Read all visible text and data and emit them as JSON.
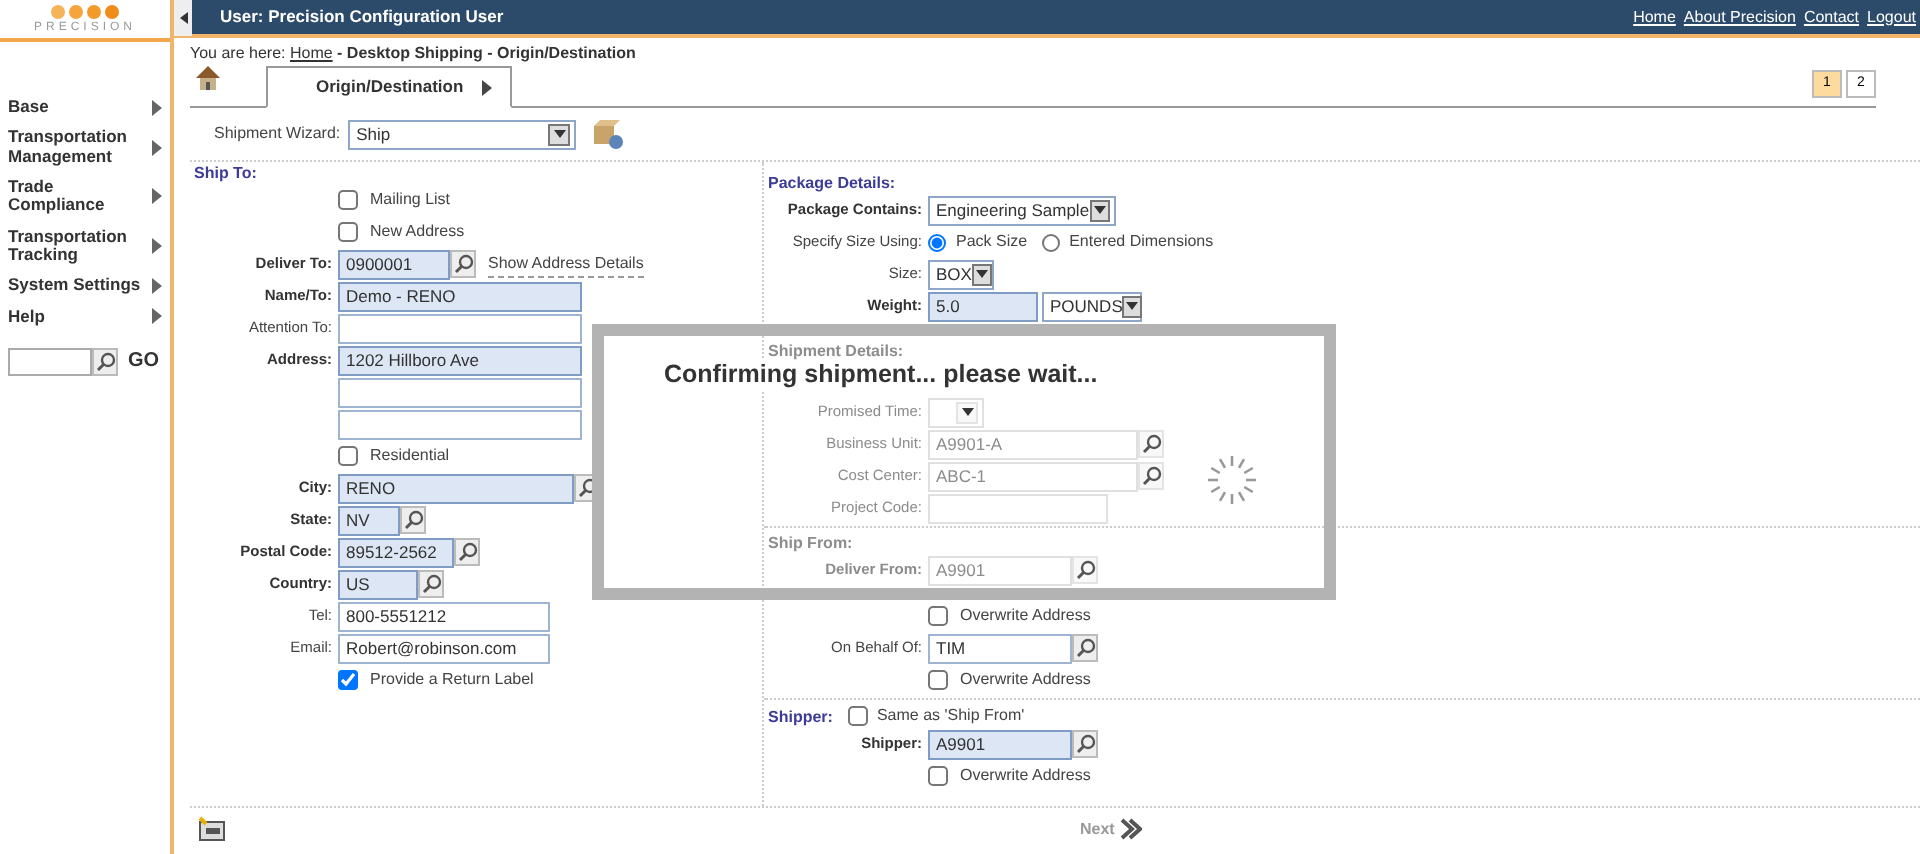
{
  "logo": {
    "text": "PRECISION"
  },
  "header": {
    "user": "User: Precision Configuration User",
    "links": [
      "Home",
      "About Precision",
      "Contact",
      "Logout"
    ]
  },
  "sidebar": {
    "items": [
      {
        "label": "Base"
      },
      {
        "label": "Transportation Management"
      },
      {
        "label": "Trade Compliance"
      },
      {
        "label": "Transportation Tracking"
      },
      {
        "label": "System Settings"
      },
      {
        "label": "Help"
      }
    ],
    "go": "GO"
  },
  "breadcrumb": {
    "prefix": "You are here:",
    "link": "Home",
    "rest": "- Desktop Shipping - Origin/Destination"
  },
  "tabs": [
    {
      "label": "Origin/Destination",
      "selected": true
    }
  ],
  "pager": [
    {
      "label": "1",
      "selected": true
    },
    {
      "label": "2",
      "selected": false
    }
  ],
  "wizard": {
    "label": "Shipment Wizard:",
    "value": "Ship"
  },
  "ship_to": {
    "title": "Ship To:",
    "fields": [
      {
        "kind": "checkbox",
        "label": "Mailing List",
        "checked": false
      },
      {
        "kind": "checkbox",
        "label": "New Address",
        "checked": false
      },
      {
        "kind": "lookup",
        "label": "Deliver To:",
        "value": "0900001",
        "required": true,
        "link": "Show Address Details"
      },
      {
        "kind": "text",
        "label": "Name/To:",
        "value": "Demo - RENO",
        "required": true
      },
      {
        "kind": "text",
        "label": "Attention To:",
        "required": false
      },
      {
        "kind": "address",
        "label": "Address:",
        "value": "1202 Hillboro Ave",
        "required": true
      },
      {
        "kind": "checkbox",
        "label": "Residential",
        "checked": false
      },
      {
        "kind": "lookup",
        "label": "City:",
        "value": "RENO",
        "required": true
      },
      {
        "kind": "lookup",
        "label": "State:",
        "value": "NV",
        "required": true
      },
      {
        "kind": "lookup",
        "label": "Postal Code:",
        "value": "89512-2562",
        "required": true
      },
      {
        "kind": "lookup",
        "label": "Country:",
        "value": "US",
        "required": true
      },
      {
        "kind": "text",
        "label": "Tel:",
        "value": "800-5551212",
        "required": false
      },
      {
        "kind": "text",
        "label": "Email:",
        "value": "Robert@robinson.com",
        "required": false
      },
      {
        "kind": "checkbox",
        "label": "Provide a Return Label",
        "checked": true
      }
    ]
  },
  "sections": [
    {
      "title": "Package Details:",
      "dimmed": false,
      "rows": [
        {
          "kind": "select",
          "label": "Package Contains:",
          "value": "Engineering Sample",
          "required": true
        },
        {
          "kind": "radio",
          "label": "Specify Size Using:",
          "options": [
            {
              "label": "Pack Size",
              "selected": true
            },
            {
              "label": "Entered Dimensions",
              "selected": false
            }
          ]
        },
        {
          "kind": "select",
          "label": "Size:",
          "value": "BOX",
          "required": false
        },
        {
          "kind": "weight",
          "label": "Weight:",
          "value": "5.0",
          "unit": "POUNDS",
          "required": true
        }
      ]
    },
    {
      "title": "Shipment Details:",
      "dimmed": true,
      "rows": [
        {
          "kind": "select",
          "label": "Promised Time:",
          "required": false
        },
        {
          "kind": "lookup",
          "label": "Business Unit:",
          "value": "A9901-A",
          "required": false
        },
        {
          "kind": "lookup",
          "label": "Cost Center:",
          "value": "ABC-1",
          "required": false
        },
        {
          "kind": "text",
          "label": "Project Code:",
          "required": false
        }
      ]
    },
    {
      "title": "Ship From:",
      "dimmed": true,
      "rows": [
        {
          "kind": "lookup",
          "label": "Deliver From:",
          "value": "A9901",
          "required": true
        }
      ]
    },
    {
      "dimmed": false,
      "rows": [
        {
          "kind": "checkbox",
          "label": "Overwrite Address",
          "checked": false
        },
        {
          "kind": "lookup",
          "label": "On Behalf Of:",
          "value": "TIM",
          "required": false
        },
        {
          "kind": "checkbox",
          "label": "Overwrite Address",
          "checked": false
        }
      ]
    },
    {
      "title": "Shipper:",
      "title_checkbox": {
        "label": "Same as 'Ship From'",
        "checked": false
      },
      "dimmed": false,
      "rows": [
        {
          "kind": "lookup",
          "label": "Shipper:",
          "value": "A9901",
          "required": true
        },
        {
          "kind": "checkbox",
          "label": "Overwrite Address",
          "checked": false
        }
      ]
    }
  ],
  "modal": {
    "message": "Confirming shipment... please wait..."
  },
  "footer": {
    "next": "Next"
  }
}
